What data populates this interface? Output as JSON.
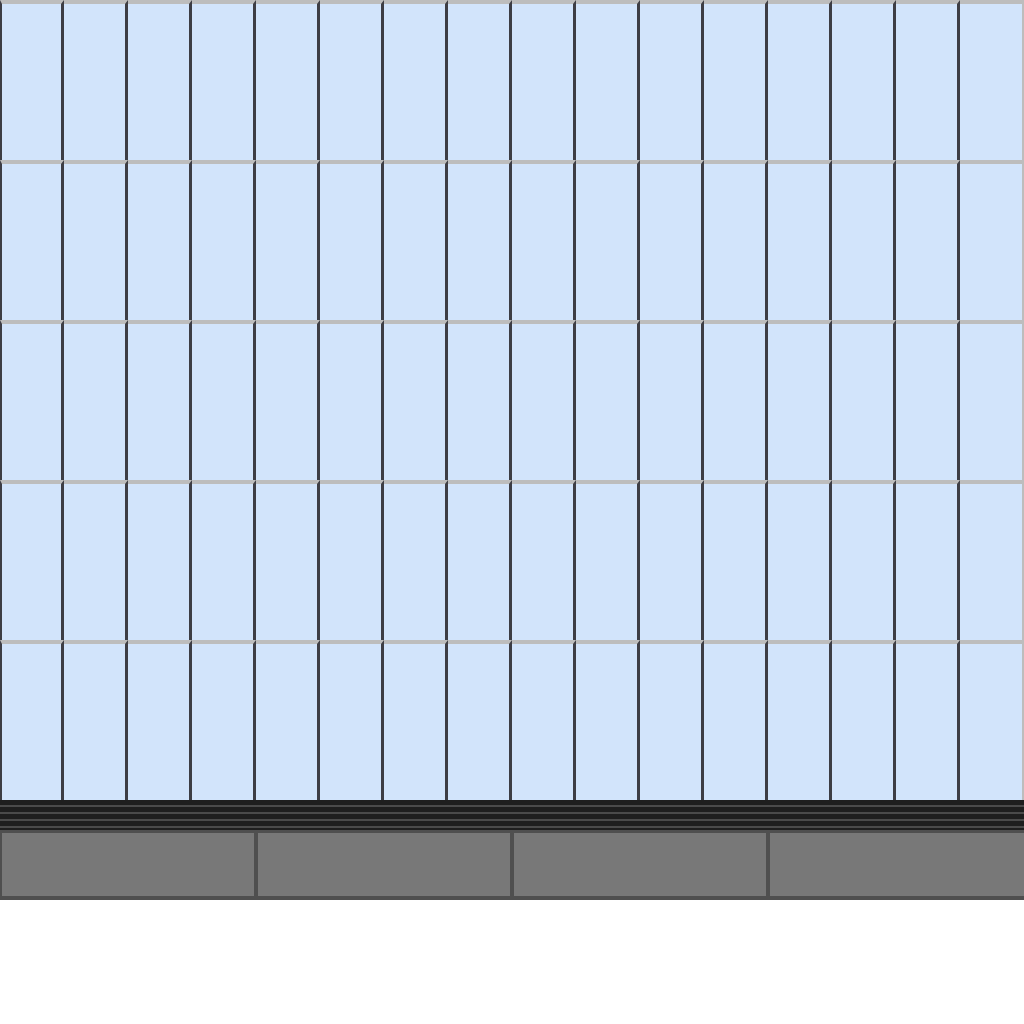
{
  "layout_grid": {
    "rows": 5,
    "columns": 16
  },
  "bottom_panels": [
    {
      "label": ""
    },
    {
      "label": ""
    },
    {
      "label": ""
    },
    {
      "label": ""
    }
  ],
  "colors": {
    "cell_fill": "#d2e4fb",
    "vertical_divider": "#3d3d44",
    "horizontal_divider": "#bdbdbd",
    "separator_band": "#1e1e1e",
    "panel_fill": "#787878",
    "panel_border": "#4f4f4f",
    "background": "#ffffff"
  }
}
